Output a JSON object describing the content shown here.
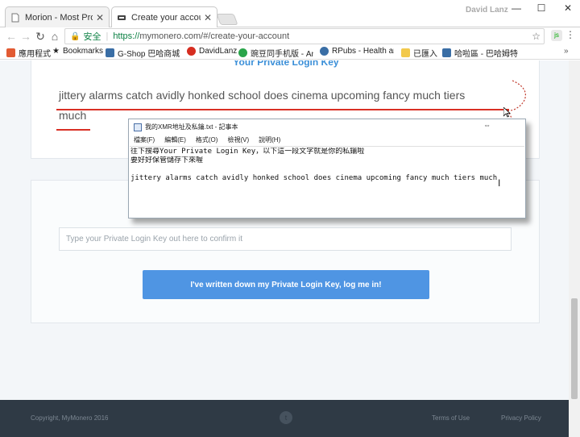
{
  "browser": {
    "tabs": [
      {
        "title": "Morion - Most Profitab",
        "active": false
      },
      {
        "title": "Create your account - ",
        "active": true
      }
    ],
    "user": "David Lanz",
    "window_controls": {
      "minimize": "—",
      "maximize": "☐",
      "close": "✕"
    },
    "address": {
      "secure_label": "安全",
      "url_scheme": "https://",
      "url_rest": "mymonero.com/#/create-your-account"
    },
    "extension_label": "js"
  },
  "bookmarks": [
    {
      "label": "應用程式",
      "icon_color": "#e25b33"
    },
    {
      "label": "Bookmarks",
      "icon_color": "#444444"
    },
    {
      "label": "G-Shop 巴哈商城 - 巴",
      "icon_color": "#3a6ea5"
    },
    {
      "label": "DavidLanz",
      "icon_color": "#d62d20"
    },
    {
      "label": "豌豆同手机版 - Andr",
      "icon_color": "#2aa44a"
    },
    {
      "label": "RPubs - Health and",
      "icon_color": "#3a6ea5"
    },
    {
      "label": "已匯入",
      "icon_color": "#f2c94c"
    },
    {
      "label": "哈啦區 - 巴哈姆特",
      "icon_color": "#3a6ea5"
    }
  ],
  "bookmarks_more": "»",
  "page": {
    "heading": "Your Private Login Key",
    "key_line1": "jittery alarms catch avidly honked school does cinema upcoming fancy much tiers",
    "key_line2": "much",
    "confirm_placeholder": "Type your Private Login Key out here to confirm it",
    "login_button": "I've written down my Private Login Key, log me in!"
  },
  "footer": {
    "copyright": "Copyright, MyMonero 2016",
    "terms": "Terms of Use",
    "privacy": "Privacy Policy"
  },
  "notepad": {
    "title": "我的XMR地址及私鑰.txt - 記事本",
    "menu": [
      "檔案(F)",
      "編輯(E)",
      "格式(O)",
      "檢視(V)",
      "說明(H)"
    ],
    "lines": [
      "往下搜尋Your Private Login Key，以下這一段文字就是你的私鑰啦",
      "要好好保管儲存下來喔",
      "",
      "jittery alarms catch avidly honked school does cinema upcoming fancy much tiers much"
    ]
  },
  "colors": {
    "accent": "#4f95e3",
    "heading": "#3b8fd8",
    "underline": "#d93025",
    "footer_bg": "#2f3a45"
  }
}
